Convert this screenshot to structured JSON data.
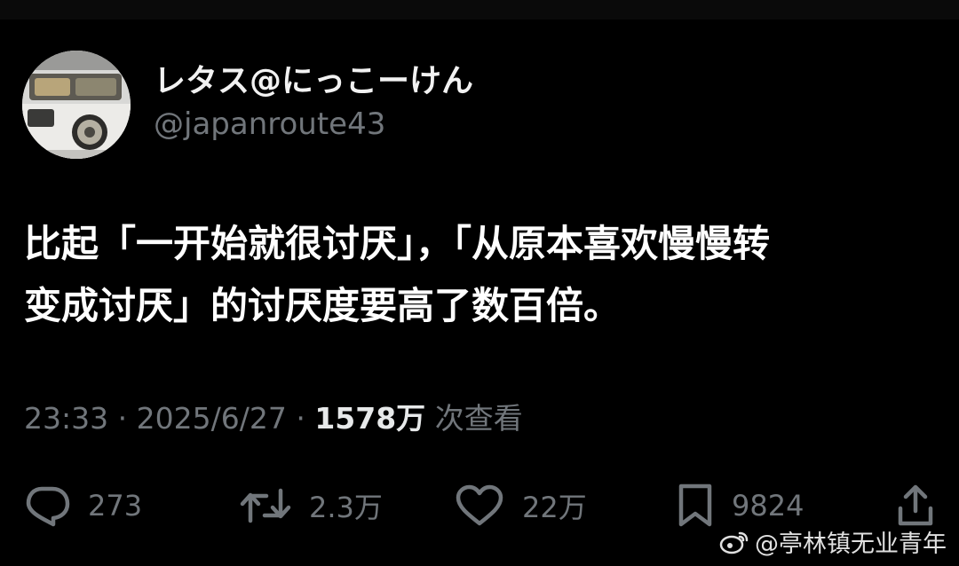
{
  "author": {
    "display_name": "レタス@にっこーけん",
    "handle": "@japanroute43",
    "avatar": "car-headlight-photo"
  },
  "tweet": {
    "line1": "比起「一开始就很讨厌」，「从原本喜欢慢慢转",
    "line2": "变成讨厌」的讨厌度要高了数百倍。"
  },
  "meta": {
    "time": "23:33",
    "separator1": "·",
    "date": "2025/6/27",
    "separator2": "·",
    "views_count": "1578万",
    "views_label": "次查看"
  },
  "actions": {
    "reply": {
      "icon": "reply-icon",
      "count": "273"
    },
    "retweet": {
      "icon": "retweet-icon",
      "count": "2.3万"
    },
    "like": {
      "icon": "heart-icon",
      "count": "22万"
    },
    "bookmark": {
      "icon": "bookmark-icon",
      "count": "9824"
    },
    "share": {
      "icon": "share-icon"
    }
  },
  "watermark": {
    "icon": "weibo-logo-icon",
    "text": "@亭林镇无业青年"
  },
  "colors": {
    "background": "#000000",
    "text": "#ffffff",
    "muted": "#71767b"
  }
}
